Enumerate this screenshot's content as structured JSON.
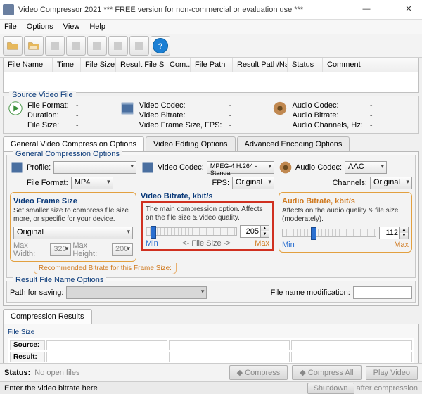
{
  "window": {
    "title": "Video Compressor 2021    *** FREE version for non-commercial or evaluation use ***"
  },
  "menu": {
    "file": "File",
    "options": "Options",
    "view": "View",
    "help": "Help"
  },
  "table": {
    "cols": [
      "File Name",
      "Time",
      "File Size",
      "Result File Size",
      "Com...",
      "File Path",
      "Result Path/Na...",
      "Status",
      "Comment"
    ],
    "widths": [
      70,
      40,
      50,
      70,
      36,
      60,
      78,
      50,
      60
    ]
  },
  "svf": {
    "title": "Source Video File",
    "file_format": "File Format:",
    "duration": "Duration:",
    "file_size": "File Size:",
    "video_codec": "Video Codec:",
    "video_bitrate": "Video Bitrate:",
    "video_fps": "Video Frame Size, FPS:",
    "audio_codec": "Audio Codec:",
    "audio_bitrate": "Audio Bitrate:",
    "audio_channels": "Audio Channels, Hz:",
    "dash": "-"
  },
  "tabs": {
    "t1": "General Video Compression Options",
    "t2": "Video Editing Options",
    "t3": "Advanced Encoding Options"
  },
  "gco": {
    "title": "General Compression Options",
    "profile": "Profile:",
    "file_format": "File Format:",
    "file_format_val": "MP4",
    "video_codec": "Video Codec:",
    "video_codec_val": "MPEG-4 H.264 - Standar",
    "fps": "FPS:",
    "fps_val": "Original",
    "audio_codec": "Audio Codec:",
    "audio_codec_val": "AAC",
    "channels": "Channels:",
    "channels_val": "Original"
  },
  "vfs": {
    "title": "Video Frame Size",
    "desc": "Set smaller size to compress file size more, or specific for your device.",
    "value": "Original",
    "max_w_lbl": "Max Width:",
    "max_w": "320",
    "max_h_lbl": "Max Height:",
    "max_h": "200"
  },
  "vbr": {
    "title": "Video Bitrate, kbit/s",
    "desc": "The main compression option. Affects on the file size & video quality.",
    "value": "205",
    "min": "Min",
    "max": "Max",
    "mid": "<-  File Size  ->",
    "rec": "Recommended Bitrate for this Frame Size:"
  },
  "abr": {
    "title": "Audio Bitrate, kbit/s",
    "desc": "Affects on the audio quality & file size (moderately).",
    "value": "112",
    "min": "Min",
    "max": "Max"
  },
  "rfno": {
    "title": "Result File Name Options",
    "path_lbl": "Path for saving:",
    "mod_lbl": "File name modification:"
  },
  "cr": {
    "title": "Compression Results",
    "fs": "File Size",
    "source": "Source:",
    "result": "Result:"
  },
  "status": {
    "label": "Status:",
    "value": "No open files"
  },
  "buttons": {
    "compress": "Compress",
    "compress_all": "Compress All",
    "play": "Play Video",
    "shutdown": "Shutdown",
    "after": "after compression"
  },
  "footer": {
    "hint": "Enter the video bitrate here"
  }
}
